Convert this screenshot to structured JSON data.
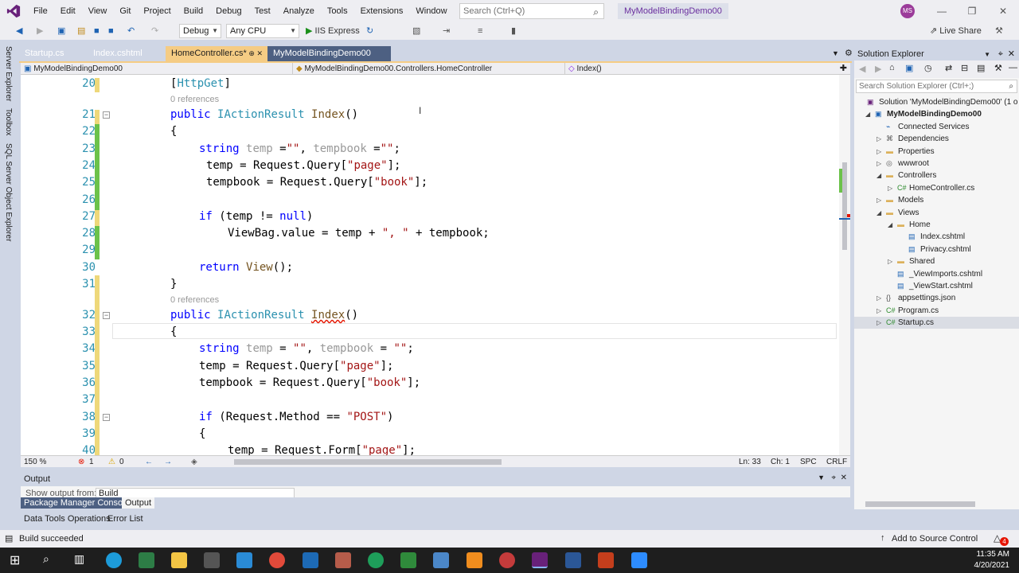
{
  "menu": {
    "items": [
      "File",
      "Edit",
      "View",
      "Git",
      "Project",
      "Build",
      "Debug",
      "Test",
      "Analyze",
      "Tools",
      "Extensions",
      "Window",
      "Help"
    ],
    "search_placeholder": "Search (Ctrl+Q)",
    "solution_name": "MyModelBindingDemo00",
    "avatar_initials": "MS"
  },
  "toolbar": {
    "config": "Debug",
    "platform": "Any CPU",
    "run_label": "IIS Express",
    "live_share": "Live Share"
  },
  "left_strip": [
    "Server Explorer",
    "Toolbox",
    "SQL Server Object Explorer"
  ],
  "tabs": [
    {
      "label": "Startup.cs"
    },
    {
      "label": "Index.cshtml"
    },
    {
      "label": "HomeController.cs*",
      "pin": "⊕ ✕"
    },
    {
      "label": "MyModelBindingDemo00"
    }
  ],
  "navbar": {
    "project": "MyModelBindingDemo00",
    "class": "MyModelBindingDemo00.Controllers.HomeController",
    "member": "Index()"
  },
  "editor": {
    "references": [
      "0 references",
      "0 references"
    ],
    "lines": [
      "20",
      "21",
      "22",
      "23",
      "24",
      "25",
      "26",
      "27",
      "28",
      "29",
      "30",
      "31",
      "32",
      "33",
      "34",
      "35",
      "36",
      "37",
      "38",
      "39",
      "40"
    ]
  },
  "edstatus": {
    "zoom": "150 %",
    "errors": "1",
    "warnings": "0",
    "ln": "Ln: 33",
    "ch": "Ch: 1",
    "spc": "SPC",
    "crlf": "CRLF"
  },
  "output": {
    "title": "Output",
    "show_from": "Show output from:",
    "source": "Build",
    "tabs": [
      "Package Manager Console",
      "Output"
    ],
    "tabs2": [
      "Data Tools Operations",
      "Error List"
    ]
  },
  "solution_explorer": {
    "title": "Solution Explorer",
    "search_placeholder": "Search Solution Explorer (Ctrl+;)",
    "items": [
      {
        "label": "Solution 'MyModelBindingDemo00' (1 o",
        "icon": "sln-icon",
        "arrow": ""
      },
      {
        "label": "MyModelBindingDemo00",
        "icon": "project-icon",
        "arrow": "◢"
      },
      {
        "label": "Connected Services",
        "icon": "connected-icon",
        "arrow": ""
      },
      {
        "label": "Dependencies",
        "icon": "deps-icon",
        "arrow": "▷"
      },
      {
        "label": "Properties",
        "icon": "folder-icon",
        "arrow": "▷"
      },
      {
        "label": "wwwroot",
        "icon": "globe-icon",
        "arrow": "▷"
      },
      {
        "label": "Controllers",
        "icon": "folder-icon",
        "arrow": "◢"
      },
      {
        "label": "HomeController.cs",
        "icon": "cs-icon",
        "arrow": "▷"
      },
      {
        "label": "Models",
        "icon": "folder-icon",
        "arrow": "▷"
      },
      {
        "label": "Views",
        "icon": "folder-icon",
        "arrow": "◢"
      },
      {
        "label": "Home",
        "icon": "folder-icon",
        "arrow": "◢"
      },
      {
        "label": "Index.cshtml",
        "icon": "cshtml-icon",
        "arrow": ""
      },
      {
        "label": "Privacy.cshtml",
        "icon": "cshtml-icon",
        "arrow": ""
      },
      {
        "label": "Shared",
        "icon": "folder-icon",
        "arrow": "▷"
      },
      {
        "label": "_ViewImports.cshtml",
        "icon": "cshtml-icon",
        "arrow": ""
      },
      {
        "label": "_ViewStart.cshtml",
        "icon": "cshtml-icon",
        "arrow": ""
      },
      {
        "label": "appsettings.json",
        "icon": "json-icon",
        "arrow": "▷"
      },
      {
        "label": "Program.cs",
        "icon": "cs-icon",
        "arrow": "▷"
      },
      {
        "label": "Startup.cs",
        "icon": "cs-icon",
        "arrow": "▷"
      }
    ]
  },
  "statusbar": {
    "message": "Build succeeded",
    "source_control": "Add to Source Control",
    "notifications": "4"
  },
  "taskbar": {
    "time": "11:35 AM",
    "date": "4/20/2021"
  },
  "colors": {
    "accent": "#68217a",
    "active_tab": "#f5cc84",
    "tab_selected": "#4d6082",
    "chrome": "#cfd6e5"
  }
}
